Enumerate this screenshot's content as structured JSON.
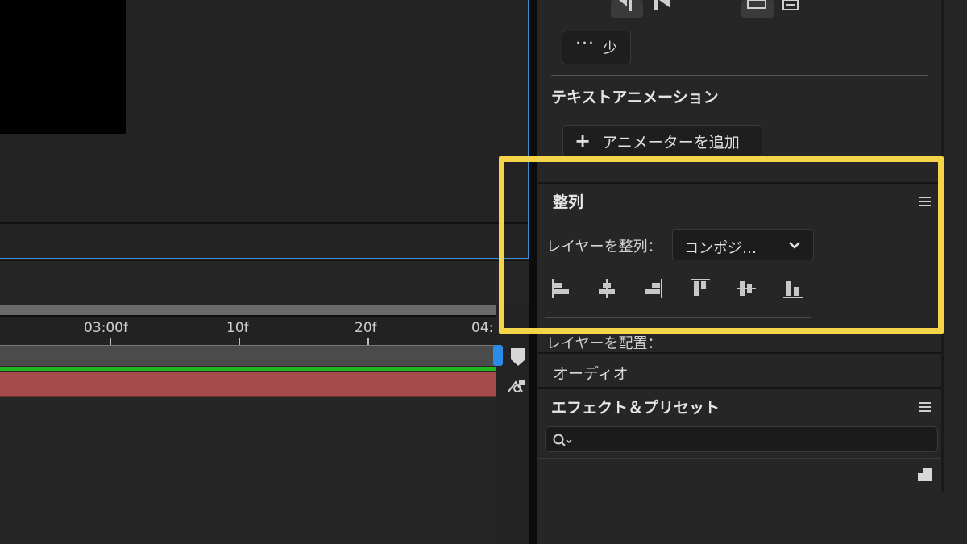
{
  "right_panel": {
    "less_button": {
      "label": "少",
      "icon": "ellipsis-icon"
    },
    "text_animation": {
      "title": "テキストアニメーション",
      "add_animator_label": "アニメーターを追加",
      "add_icon": "plus-icon"
    },
    "align": {
      "title": "整列",
      "align_layers_label": "レイヤーを整列：",
      "align_to_value": "コンポジ…",
      "buttons": [
        "align-left-icon",
        "align-horizontal-center-icon",
        "align-right-icon",
        "align-top-icon",
        "align-vertical-center-icon",
        "align-bottom-icon"
      ],
      "distribute_label": "レイヤーを配置："
    },
    "audio": {
      "label": "オーディオ"
    },
    "effects": {
      "title": "エフェクト＆プリセット",
      "search_value": ""
    }
  },
  "timeline": {
    "ruler_ticks": [
      "03:00f",
      "10f",
      "20f",
      "04:"
    ]
  },
  "colors": {
    "highlight": "#f5d44a",
    "playhead": "#2a8be8",
    "audio_track": "#22b622",
    "layer_bar": "#a54b4b",
    "comp_frame": "#3d8bd6"
  }
}
